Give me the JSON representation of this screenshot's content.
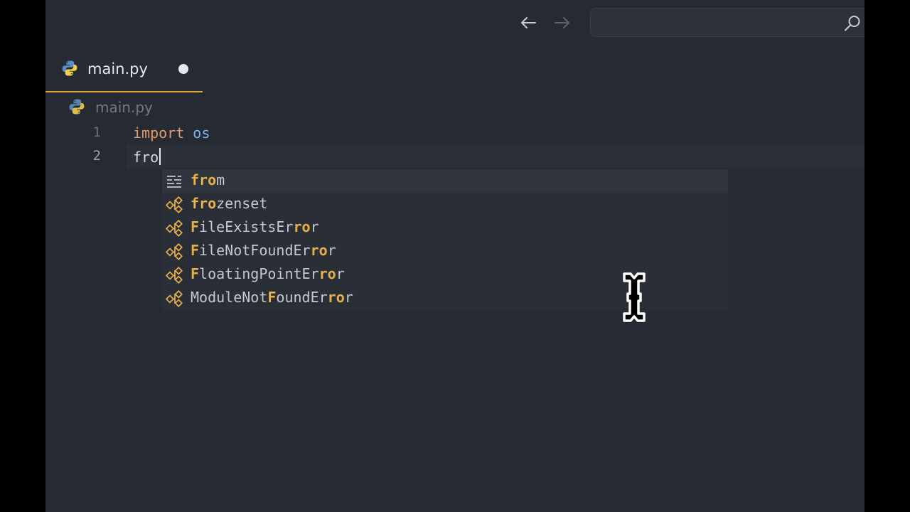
{
  "titlebar": {
    "back_icon": "arrow-left-icon",
    "forward_icon": "arrow-right-icon",
    "search": {
      "value": "",
      "placeholder": "",
      "icon": "search-icon"
    }
  },
  "tab": {
    "title": "main.py",
    "icon": "python-icon",
    "unsaved_indicator": "dot",
    "active_color": "#d9a53a"
  },
  "breadcrumb": {
    "label": "main.py",
    "icon": "python-icon"
  },
  "editor": {
    "lines": [
      {
        "number": "1",
        "keyword": "import",
        "rest": " os"
      },
      {
        "number": "2",
        "text": "fro"
      }
    ]
  },
  "autocomplete": {
    "query": "fro",
    "items": [
      {
        "kind": "keyword",
        "icon": "keyword-icon",
        "parts": [
          {
            "t": "fro",
            "m": true
          },
          {
            "t": "m",
            "m": false
          }
        ]
      },
      {
        "kind": "class",
        "icon": "class-icon",
        "parts": [
          {
            "t": "fro",
            "m": true
          },
          {
            "t": "zenset",
            "m": false
          }
        ]
      },
      {
        "kind": "class",
        "icon": "class-icon",
        "parts": [
          {
            "t": "F",
            "m": true
          },
          {
            "t": "ileExistsEr",
            "m": false
          },
          {
            "t": "ro",
            "m": true
          },
          {
            "t": "r",
            "m": false
          }
        ]
      },
      {
        "kind": "class",
        "icon": "class-icon",
        "parts": [
          {
            "t": "F",
            "m": true
          },
          {
            "t": "ileNotFoundEr",
            "m": false
          },
          {
            "t": "ro",
            "m": true
          },
          {
            "t": "r",
            "m": false
          }
        ]
      },
      {
        "kind": "class",
        "icon": "class-icon",
        "parts": [
          {
            "t": "F",
            "m": true
          },
          {
            "t": "loatingPointEr",
            "m": false
          },
          {
            "t": "ro",
            "m": true
          },
          {
            "t": "r",
            "m": false
          }
        ]
      },
      {
        "kind": "class",
        "icon": "class-icon",
        "parts": [
          {
            "t": "ModuleNot",
            "m": false
          },
          {
            "t": "F",
            "m": true
          },
          {
            "t": "oundEr",
            "m": false
          },
          {
            "t": "ro",
            "m": true
          },
          {
            "t": "r",
            "m": false
          }
        ]
      }
    ],
    "highlight_color": "#e8b04b"
  },
  "pointer": {
    "icon": "text-cursor-icon"
  }
}
